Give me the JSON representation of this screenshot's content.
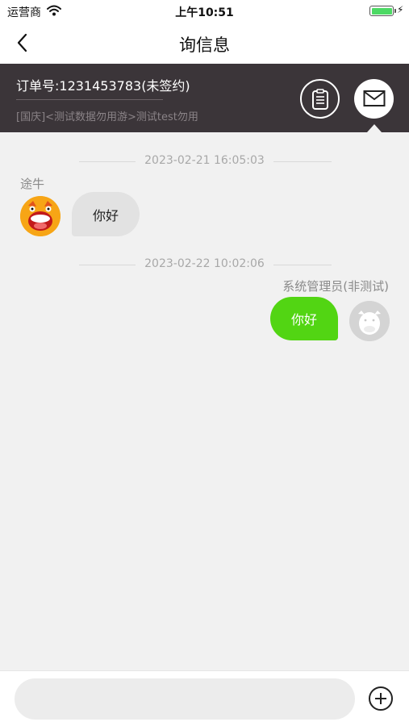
{
  "status_bar": {
    "carrier": "运营商",
    "time": "上午10:51",
    "wifi_icon": "wifi-icon",
    "battery_icon": "battery-icon",
    "charge_icon": "charging-bolt-icon"
  },
  "nav": {
    "title": "询信息",
    "back_icon": "chevron-left-icon"
  },
  "order": {
    "number": "订单号:1231453783(未签约)",
    "route": "[国庆]<测试数据勿用游>测试test勿用",
    "clipboard_icon": "clipboard-icon",
    "message_icon": "envelope-icon"
  },
  "chat": {
    "messages": [
      {
        "timestamp": "2023-02-21 16:05:03",
        "sender": "途牛",
        "text": "你好",
        "side": "left"
      },
      {
        "timestamp": "2023-02-22 10:02:06",
        "sender": "系统管理员(非测试)",
        "text": "你好",
        "side": "right"
      }
    ]
  },
  "input": {
    "placeholder": "",
    "value": "",
    "add_icon": "plus-circle-icon"
  },
  "colors": {
    "order_panel_bg": "#3b3539",
    "chat_bg": "#f1f1f1",
    "own_bubble": "#52d513",
    "other_bubble": "#e2e2e2"
  }
}
